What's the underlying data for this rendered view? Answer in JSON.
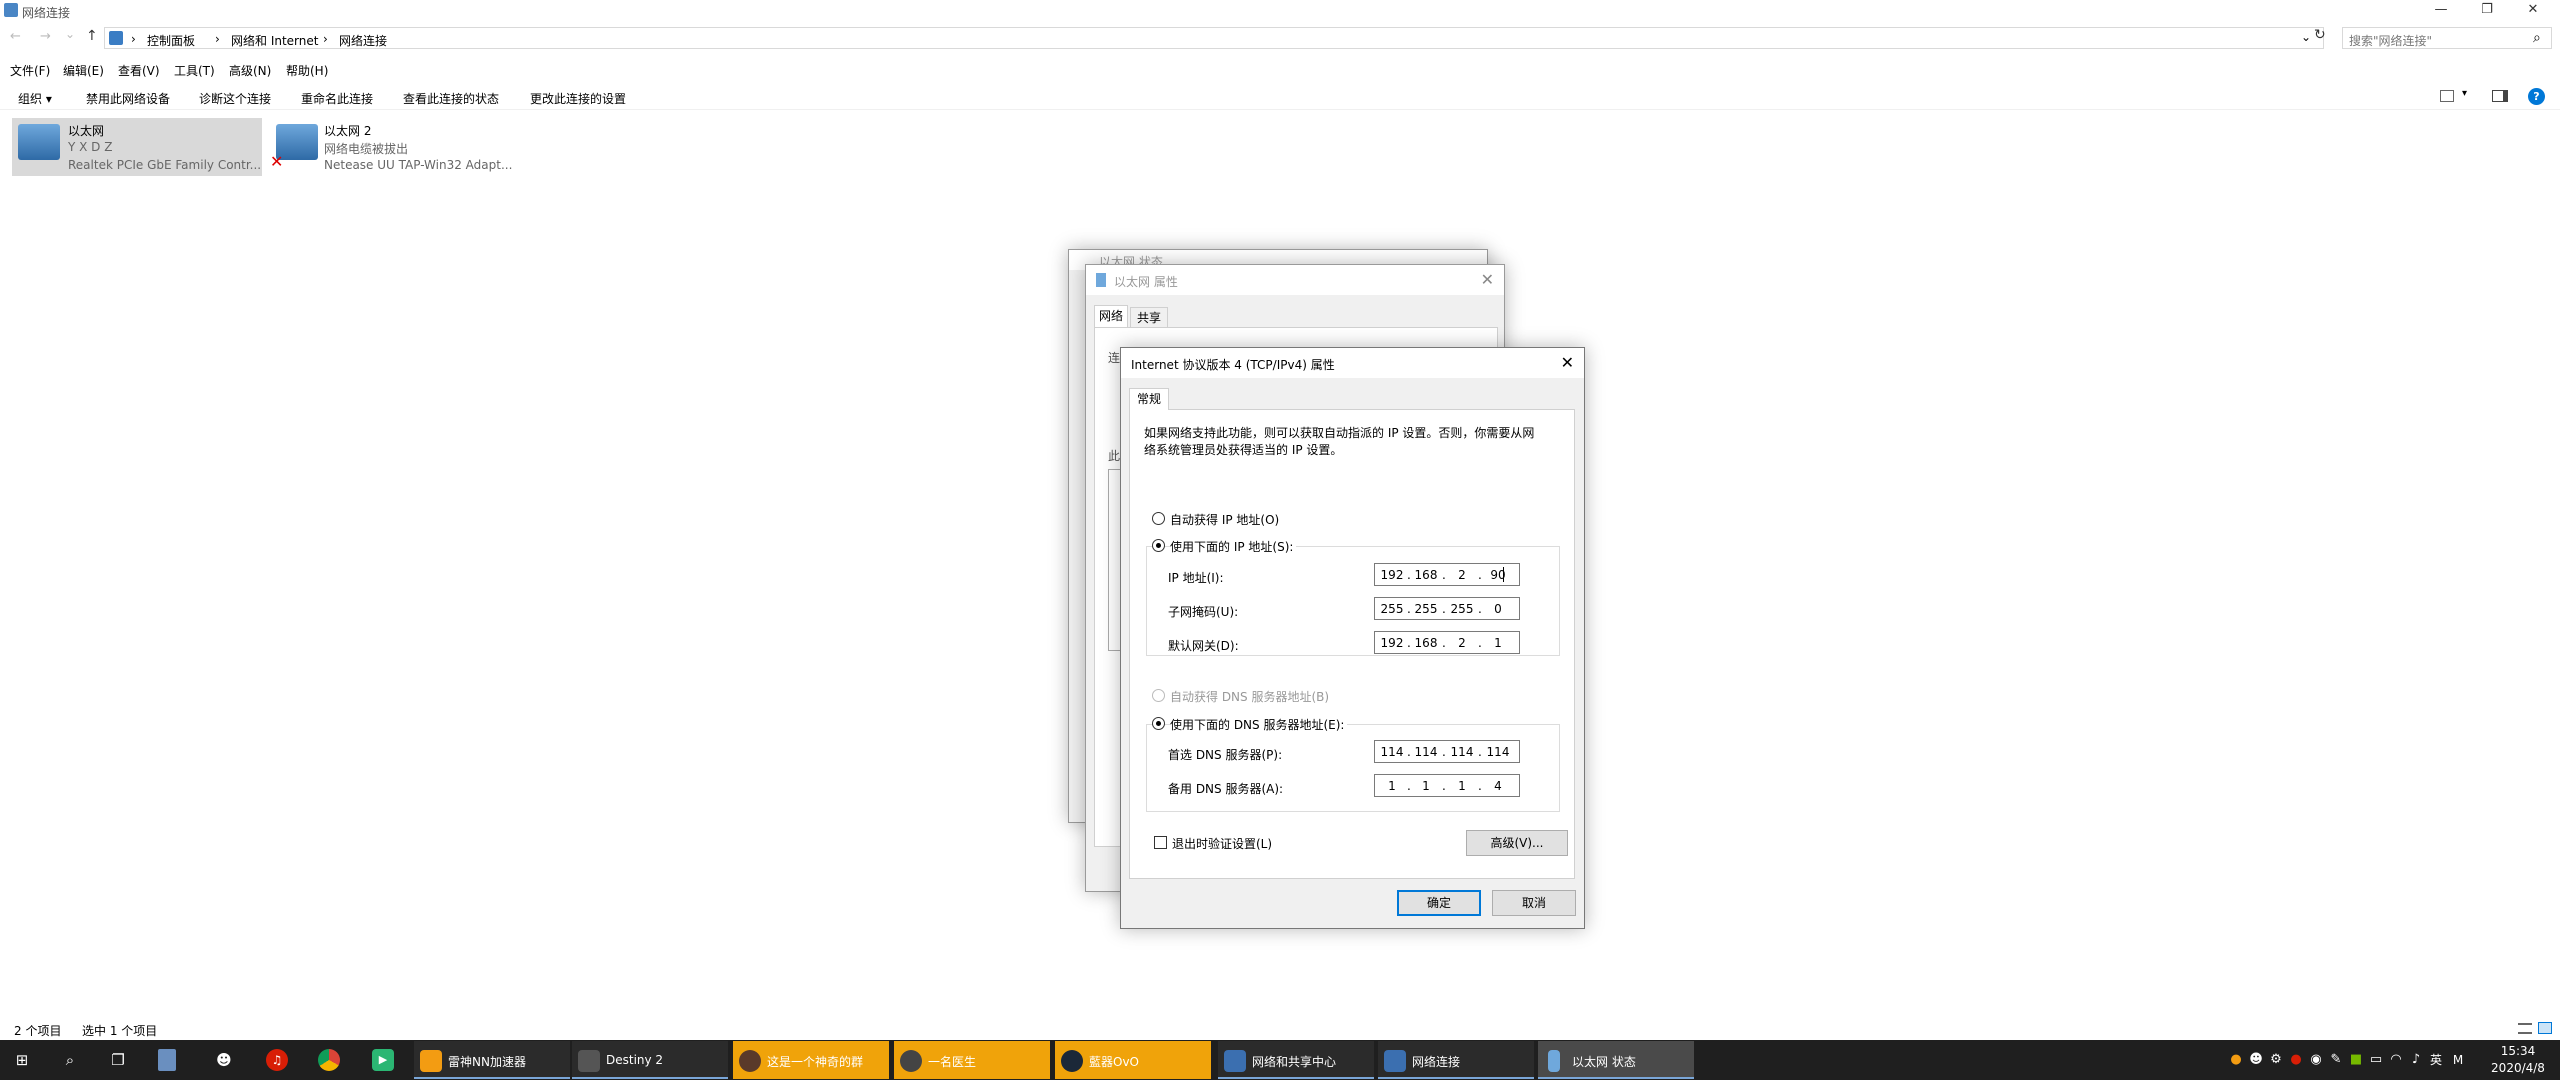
{
  "window": {
    "title": "网络连接",
    "minimize": "—",
    "restore": "❐",
    "close": "✕"
  },
  "nav": {
    "back": "←",
    "forward": "→",
    "recent": "⌄",
    "up": "↑",
    "breadcrumb": [
      "控制面板",
      "网络和 Internet",
      "网络连接"
    ],
    "separator": "›",
    "refresh": "↻",
    "dropdown": "⌄",
    "search_placeholder": "搜索\"网络连接\"",
    "search_icon": "⌕"
  },
  "menu": [
    "文件(F)",
    "编辑(E)",
    "查看(V)",
    "工具(T)",
    "高级(N)",
    "帮助(H)"
  ],
  "commands": {
    "organize": "组织 ▾",
    "items": [
      "禁用此网络设备",
      "诊断这个连接",
      "重命名此连接",
      "查看此连接的状态",
      "更改此连接的设置"
    ]
  },
  "connections": [
    {
      "name": "以太网",
      "status": "Y X D Z",
      "device": "Realtek PCIe GbE Family Contr..."
    },
    {
      "name": "以太网 2",
      "status": "网络电缆被拔出",
      "device": "Netease UU TAP-Win32 Adapt..."
    }
  ],
  "statusbar": {
    "count": "2 个项目",
    "selected": "选中 1 个项目"
  },
  "status_dialog": {
    "title": "以太网 状态"
  },
  "props_dialog": {
    "title": "以太网 属性",
    "tabs": [
      "网络",
      "共享"
    ],
    "partial1": "连",
    "partial2": "此"
  },
  "ipv4_dialog": {
    "title": "Internet 协议版本 4 (TCP/IPv4) 属性",
    "tab": "常规",
    "description": "如果网络支持此功能，则可以获取自动指派的 IP 设置。否则，你需要从网络系统管理员处获得适当的 IP 设置。",
    "desc_line1": "如果网络支持此功能，则可以获取自动指派的 IP 设置。否则，你需要从网",
    "desc_line2": "络系统管理员处获得适当的 IP 设置。",
    "auto_ip": "自动获得 IP 地址(O)",
    "manual_ip": "使用下面的 IP 地址(S):",
    "ip_label": "IP 地址(I):",
    "ip_value": [
      "192",
      "168",
      "2",
      "90"
    ],
    "mask_label": "子网掩码(U):",
    "mask_value": [
      "255",
      "255",
      "255",
      "0"
    ],
    "gateway_label": "默认网关(D):",
    "gateway_value": [
      "192",
      "168",
      "2",
      "1"
    ],
    "auto_dns": "自动获得 DNS 服务器地址(B)",
    "manual_dns": "使用下面的 DNS 服务器地址(E):",
    "dns1_label": "首选 DNS 服务器(P):",
    "dns1_value": [
      "114",
      "114",
      "114",
      "114"
    ],
    "dns2_label": "备用 DNS 服务器(A):",
    "dns2_value": [
      "1",
      "1",
      "1",
      "4"
    ],
    "validate": "退出时验证设置(L)",
    "advanced": "高级(V)...",
    "ok": "确定",
    "cancel": "取消",
    "close": "✕"
  },
  "taskbar": {
    "apps": [
      {
        "label": "雷神NN加速器",
        "color": "#f39c12"
      },
      {
        "label": "Destiny 2",
        "color": "#555555"
      },
      {
        "label": "这是一个神奇的群",
        "color": "#f0a30a"
      },
      {
        "label": "一名医生",
        "color": "#f0a30a"
      },
      {
        "label": "藍器OvO",
        "color": "#f0a30a"
      },
      {
        "label": "网络和共享中心",
        "color": "#3a3a3a"
      },
      {
        "label": "网络连接",
        "color": "#3a3a3a"
      },
      {
        "label": "以太网 状态",
        "color": "#4a4a4a"
      }
    ],
    "tray_lang": "英",
    "tray_ime": "M",
    "time": "15:34",
    "date": "2020/4/8"
  },
  "colors": {
    "accent": "#0078d7",
    "taskbar": "#1f1f1f",
    "highlight_orange": "#f0a30a"
  }
}
